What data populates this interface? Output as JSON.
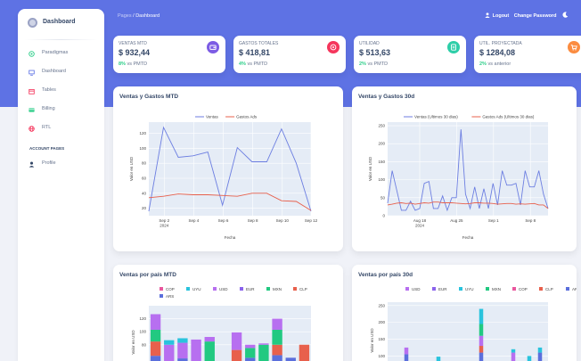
{
  "sidebar": {
    "brand": "Dashboard",
    "items": [
      {
        "label": "Paradigmas",
        "icon": "globe-icon",
        "color": "#2dce89"
      },
      {
        "label": "Dashboard",
        "icon": "monitor-icon",
        "color": "#5e72e4"
      },
      {
        "label": "Tables",
        "icon": "calendar-icon",
        "color": "#f5365c"
      },
      {
        "label": "Billing",
        "icon": "credit-card-icon",
        "color": "#2dce89"
      },
      {
        "label": "RTL",
        "icon": "world-icon",
        "color": "#f5365c"
      }
    ],
    "section_label": "ACCOUNT PAGES",
    "profile_label": "Profile"
  },
  "topbar": {
    "breadcrumb_parent": "Pages",
    "breadcrumb_sep": "/",
    "breadcrumb_current": "Dashboard",
    "logout": "Logout",
    "change_password": "Change Password"
  },
  "stats": [
    {
      "label": "VENTAS MTD",
      "value": "$ 932,44",
      "pct": "8%",
      "suffix": "vs PMTD",
      "icon": "wallet-icon",
      "color": "#7c5ce4"
    },
    {
      "label": "GASTOS TOTALES",
      "value": "$ 418,81",
      "pct": "4%",
      "suffix": "vs PMTD",
      "icon": "globe-icon",
      "color": "#f5365c"
    },
    {
      "label": "UTILIDAD",
      "value": "$ 513,63",
      "pct": "2%",
      "suffix": "vs PMTD",
      "icon": "document-icon",
      "color": "#2dcea8"
    },
    {
      "label": "UTIL. PROYECTADA",
      "value": "$ 1284,08",
      "pct": "2%",
      "suffix": "vs anterior",
      "icon": "cart-icon",
      "color": "#fb8c40"
    }
  ],
  "cards": {
    "mtd_title": "Ventas y Gastos MTD",
    "d30_title": "Ventas y Gastos 30d",
    "pais_mtd_title": "Ventas por país MTD",
    "pais_30d_title": "Ventas por país 30d"
  },
  "chart_data": [
    {
      "type": "line",
      "title": "Ventas y Gastos MTD",
      "xlabel": "Fecha",
      "ylabel": "Valor en USD",
      "x": [
        "2024-09-01",
        "2024-09-02",
        "2024-09-03",
        "2024-09-04",
        "2024-09-05",
        "2024-09-06",
        "2024-09-07",
        "2024-09-08",
        "2024-09-09",
        "2024-09-10",
        "2024-09-11",
        "2024-09-12"
      ],
      "x_ticks": [
        "Sep 2\n2024",
        "Sep 4",
        "Sep 6",
        "Sep 8",
        "Sep 10",
        "Sep 12"
      ],
      "y_ticks": [
        20,
        40,
        60,
        80,
        100,
        120
      ],
      "ylim": [
        10,
        135
      ],
      "series": [
        {
          "name": "Ventas",
          "color": "#6c7ee1",
          "values": [
            16,
            128,
            88,
            90,
            95,
            24,
            101,
            82,
            82,
            126,
            80,
            16
          ]
        },
        {
          "name": "Gastos Ads",
          "color": "#e8604c",
          "values": [
            34,
            36,
            39,
            38,
            38,
            37,
            36,
            40,
            40,
            30,
            29,
            17
          ]
        }
      ],
      "legend": "top-center"
    },
    {
      "type": "line",
      "title": "Ventas y Gastos 30d",
      "xlabel": "Fecha",
      "ylabel": "Valor en USD",
      "x_ticks": [
        "Aug 18\n2024",
        "Aug 25",
        "Sep 1",
        "Sep 8"
      ],
      "y_ticks": [
        0,
        50,
        100,
        150,
        200,
        250
      ],
      "ylim": [
        0,
        260
      ],
      "series": [
        {
          "name": "Ventas (Ultimos 30 dias)",
          "color": "#6c7ee1",
          "values": [
            35,
            125,
            70,
            15,
            15,
            40,
            15,
            20,
            90,
            95,
            20,
            20,
            55,
            15,
            50,
            50,
            240,
            60,
            20,
            80,
            20,
            75,
            20,
            90,
            30,
            125,
            85,
            85,
            90,
            30,
            125,
            80,
            80,
            125,
            60,
            20
          ]
        },
        {
          "name": "Gastos Ads (Ultimos 30 dias)",
          "color": "#e8604c",
          "values": [
            30,
            32,
            35,
            36,
            34,
            35,
            32,
            34,
            36,
            35,
            38,
            38,
            36,
            36,
            36,
            35,
            34,
            33,
            34,
            36,
            36,
            35,
            35,
            34,
            32,
            33,
            34,
            34,
            32,
            33,
            32,
            33,
            34,
            30,
            30,
            20
          ]
        }
      ],
      "legend": "top-center"
    },
    {
      "type": "bar",
      "stacked": true,
      "title": "Ventas por país MTD",
      "ylabel": "Valor en USD",
      "y_ticks": [
        80,
        100,
        120
      ],
      "ylim": [
        55,
        140
      ],
      "legend": [
        "COP",
        "UYU",
        "USD",
        "EUR",
        "MXN",
        "CLP",
        "ARS"
      ],
      "colors": {
        "COP": "#e9579e",
        "UYU": "#29c3dd",
        "USD": "#b76ff0",
        "EUR": "#8b63ec",
        "MXN": "#22c981",
        "CLP": "#e8604c",
        "ARS": "#5b6fdc"
      },
      "series": [
        {
          "name": "ARS",
          "values": [
            63,
            0,
            59,
            0,
            0,
            0,
            0,
            60,
            0,
            64,
            60,
            0
          ]
        },
        {
          "name": "CLP",
          "values": [
            85,
            0,
            0,
            0,
            0,
            0,
            72,
            0,
            0,
            80,
            0,
            80
          ]
        },
        {
          "name": "MXN",
          "values": [
            103,
            0,
            0,
            0,
            85,
            0,
            0,
            75,
            80,
            103,
            0,
            0
          ]
        },
        {
          "name": "USD",
          "values": [
            127,
            80,
            83,
            88,
            92,
            0,
            99,
            80,
            82,
            120,
            0,
            0
          ]
        },
        {
          "name": "UYU",
          "values": [
            0,
            87,
            90,
            0,
            0,
            0,
            0,
            0,
            0,
            0,
            0,
            0
          ]
        }
      ]
    },
    {
      "type": "bar",
      "stacked": true,
      "title": "Ventas por país 30d",
      "ylabel": "Valor en USD",
      "y_ticks": [
        100,
        150,
        200,
        250
      ],
      "ylim": [
        85,
        260
      ],
      "legend": [
        "USD",
        "EUR",
        "UYU",
        "MXN",
        "COP",
        "CLP",
        "ARS"
      ]
    }
  ]
}
